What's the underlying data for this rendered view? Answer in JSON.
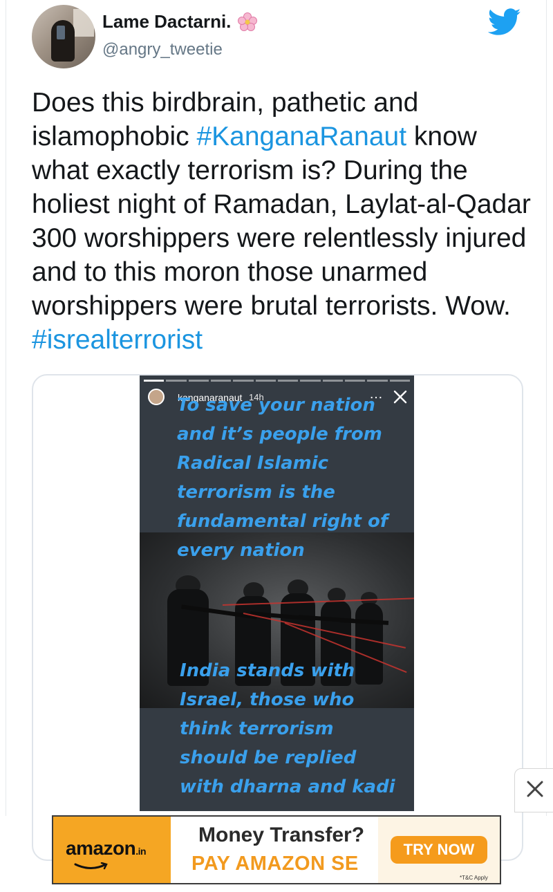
{
  "tweet": {
    "display_name": "Lame Dactarni.",
    "handle": "@angry_tweetie",
    "text_parts": [
      "Does this birdbrain, pathetic and islamophobic ",
      "#KanganaRanaut",
      " know what exactly terrorism is?  During the holiest night of Ramadan, Laylat-al-Qadar 300 worshippers were relentlessly injured and to this moron those unarmed worshippers were brutal terrorists. Wow. ",
      "#isrealterrorist"
    ]
  },
  "story": {
    "username": "kanganaranaut",
    "time": "14h",
    "more": "…",
    "text_top": "To save your nation\nand it’s people from\nRadical Islamic\nterrorism is the\nfundamental right of\nevery nation",
    "text_bottom": "India stands with\nIsrael, those who\nthink terrorism\nshould be replied\nwith dharna and kadi"
  },
  "ad": {
    "logo_text": "amazon",
    "logo_suffix": ".in",
    "title": "Money Transfer?",
    "subtitle": "PAY AMAZON SE",
    "cta": "TRY NOW",
    "terms": "*T&C Apply"
  },
  "colors": {
    "hashtag": "#1b95e0",
    "twitter_blue": "#1da1f2",
    "story_text": "#3aa0ec",
    "amazon_orange": "#f5a623"
  },
  "icons": {
    "brand": "twitter-bird-icon",
    "name_emoji": "cherry-blossom-icon",
    "story_close": "close-icon",
    "ad_close": "close-icon"
  }
}
